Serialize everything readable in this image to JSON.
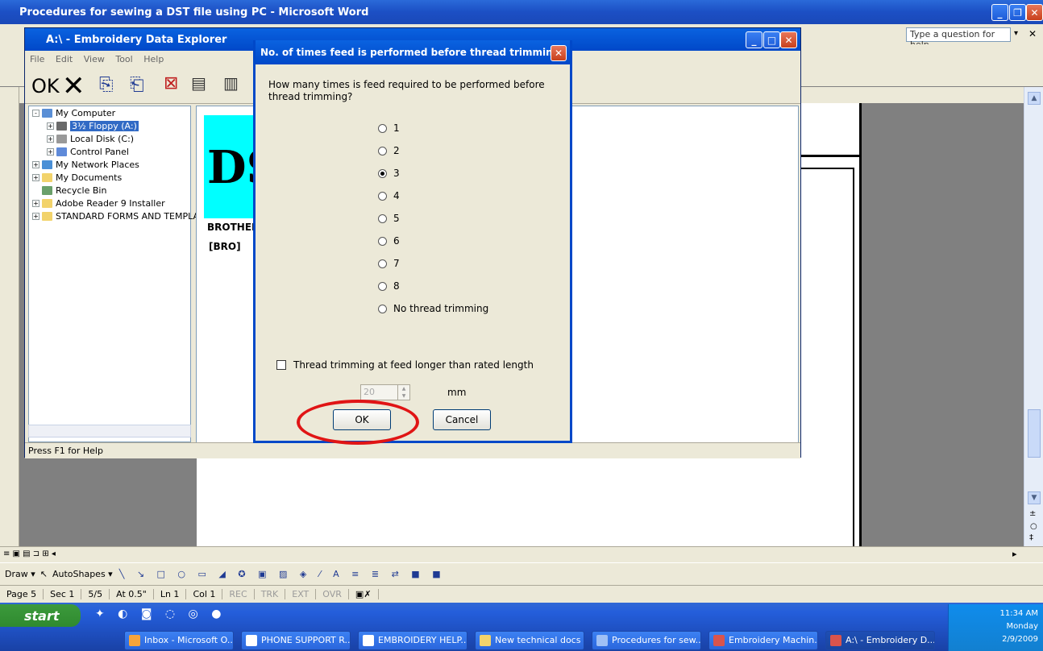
{
  "word": {
    "title": "Procedures for sewing a DST file using PC - Microsoft Word",
    "help_placeholder": "Type a question for help"
  },
  "explorer": {
    "title": "A:\\ - Embroidery Data Explorer",
    "menu": [
      "File",
      "Edit",
      "View",
      "Tool",
      "Help"
    ],
    "ok_label": "OK",
    "tree": [
      {
        "label": "My Computer",
        "level": 0,
        "icon": "computer-icon",
        "expander": "-"
      },
      {
        "label": "3½ Floppy (A:)",
        "level": 1,
        "icon": "floppy-icon",
        "expander": "+",
        "selected": true
      },
      {
        "label": "Local Disk (C:)",
        "level": 1,
        "icon": "disk-icon",
        "expander": "+"
      },
      {
        "label": "Control Panel",
        "level": 1,
        "icon": "control-panel-icon",
        "expander": "+"
      },
      {
        "label": "My Network Places",
        "level": 0,
        "icon": "network-icon",
        "expander": "+"
      },
      {
        "label": "My Documents",
        "level": 0,
        "icon": "folder-icon",
        "expander": "+"
      },
      {
        "label": "Recycle Bin",
        "level": 0,
        "icon": "recycle-bin-icon",
        "expander": ""
      },
      {
        "label": "Adobe Reader 9 Installer",
        "level": 0,
        "icon": "folder-icon",
        "expander": "+"
      },
      {
        "label": "STANDARD FORMS AND TEMPLAT",
        "level": 0,
        "icon": "folder-icon",
        "expander": "+"
      }
    ],
    "preview_big_text": "DS",
    "preview_label": "BROTHEI",
    "preview_sub": "[BRO]",
    "status": "Press F1 for Help"
  },
  "dialog": {
    "title": "No. of times feed is performed before thread trimming",
    "question": "How many times is feed required to be performed before thread trimming?",
    "options": [
      "1",
      "2",
      "3",
      "4",
      "5",
      "6",
      "7",
      "8",
      "No thread trimming"
    ],
    "selected_option": "3",
    "checkbox_label": "Thread trimming at feed longer than rated length",
    "checkbox_checked": false,
    "spin_value": "20",
    "unit": "mm",
    "ok_label": "OK",
    "cancel_label": "Cancel"
  },
  "drawbar": {
    "draw": "Draw ▾",
    "autoshapes": "AutoShapes ▾"
  },
  "statusbar": {
    "page": "Page 5",
    "sec": "Sec 1",
    "pages": "5/5",
    "at": "At 0.5\"",
    "ln": "Ln 1",
    "col": "Col 1",
    "rec": "REC",
    "trk": "TRK",
    "ext": "EXT",
    "ovr": "OVR"
  },
  "taskbar": {
    "start": "start",
    "items": [
      {
        "label": "Inbox - Microsoft O...",
        "color": "#f6a43a"
      },
      {
        "label": "PHONE SUPPORT R...",
        "color": "#ffffff"
      },
      {
        "label": "EMBROIDERY HELP...",
        "color": "#ffffff"
      },
      {
        "label": "New technical docs ...",
        "color": "#f2d36b"
      },
      {
        "label": "Procedures for sew...",
        "color": "#9fc0f5"
      },
      {
        "label": "Embroidery Machin...",
        "color": "#d9544d"
      },
      {
        "label": "A:\\ - Embroidery D...",
        "color": "#d9544d",
        "active": true
      }
    ],
    "time": "11:34 AM",
    "day": "Monday",
    "date": "2/9/2009"
  }
}
